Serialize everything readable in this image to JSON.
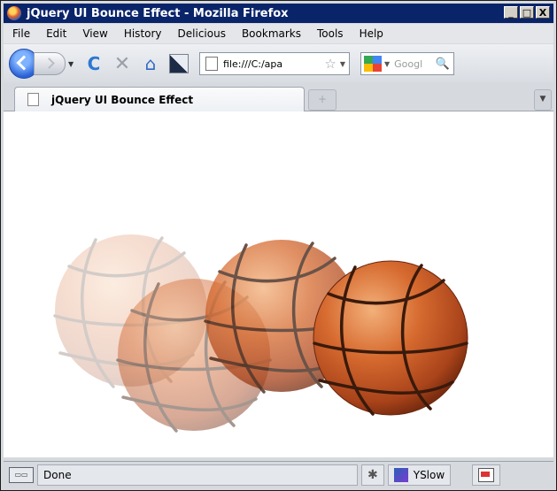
{
  "window": {
    "title": "jQuery UI Bounce Effect - Mozilla Firefox",
    "buttons": {
      "minimize": "_",
      "maximize": "□",
      "close": "X"
    }
  },
  "menubar": {
    "items": [
      {
        "label": "File"
      },
      {
        "label": "Edit"
      },
      {
        "label": "View"
      },
      {
        "label": "History"
      },
      {
        "label": "Delicious"
      },
      {
        "label": "Bookmarks"
      },
      {
        "label": "Tools"
      },
      {
        "label": "Help"
      }
    ]
  },
  "toolbar": {
    "address": "file:///C:/apa",
    "search_placeholder": "Googl",
    "icons": [
      "back-icon",
      "forward-icon",
      "reload-icon",
      "stop-icon",
      "home-icon",
      "addon-icon",
      "star-icon",
      "google-icon",
      "magnifier-icon"
    ]
  },
  "tab": {
    "label": "jQuery UI Bounce Effect"
  },
  "statusbar": {
    "status": "Done",
    "yslow_label": "YSlow"
  },
  "colors": {
    "titlebar": "#0a246a",
    "ball": "#c0531f",
    "ball_lines": "#3a1a0c"
  }
}
